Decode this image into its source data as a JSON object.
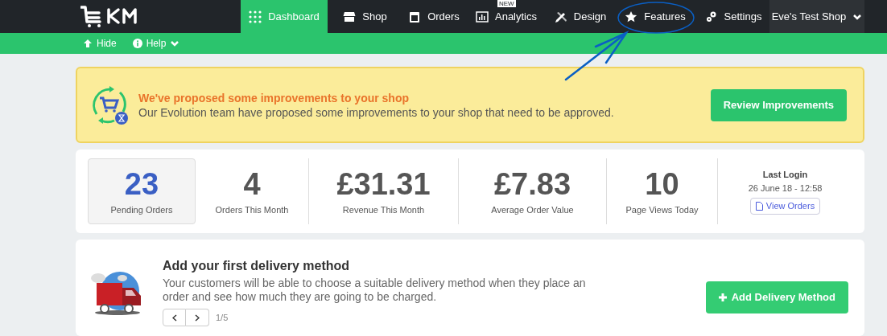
{
  "nav": {
    "items": [
      {
        "label": "Dashboard",
        "kind": "grid",
        "selected": true
      },
      {
        "label": "Shop",
        "kind": "store",
        "selected": false
      },
      {
        "label": "Orders",
        "kind": "calendar",
        "selected": false
      },
      {
        "label": "Analytics",
        "kind": "chart",
        "selected": false,
        "badge": "NEW"
      },
      {
        "label": "Design",
        "kind": "pencil",
        "selected": false
      },
      {
        "label": "Features",
        "kind": "star",
        "selected": false
      },
      {
        "label": "Settings",
        "kind": "gear",
        "selected": false
      }
    ],
    "shop_menu": "Eve's Test Shop"
  },
  "subbar": [
    {
      "label": "Hide",
      "kind": "arrow-up"
    },
    {
      "label": "Help",
      "kind": "info"
    }
  ],
  "notice": {
    "title": "We've proposed some improvements to your shop",
    "text": "Our Evolution team have proposed some improvements to your shop that need to be approved.",
    "button": "Review Improvements"
  },
  "stats": [
    {
      "value": "23",
      "label": "Pending Orders",
      "highlighted": true
    },
    {
      "value": "4",
      "label": "Orders This Month",
      "highlighted": false
    },
    {
      "value": "£31.31",
      "label": "Revenue This Month",
      "highlighted": false
    },
    {
      "value": "£7.83",
      "label": "Average Order Value",
      "highlighted": false
    },
    {
      "value": "10",
      "label": "Page Views Today",
      "highlighted": false
    }
  ],
  "last_login": {
    "title": "Last Login",
    "time": "26 June 18 - 12:58",
    "button": "View Orders"
  },
  "task": {
    "title": "Add your first delivery method",
    "text": "Your customers will be able to choose a suitable delivery method when they place an order and see how much they are going to be charged.",
    "button": "Add Delivery Method",
    "pager": "1/5"
  }
}
